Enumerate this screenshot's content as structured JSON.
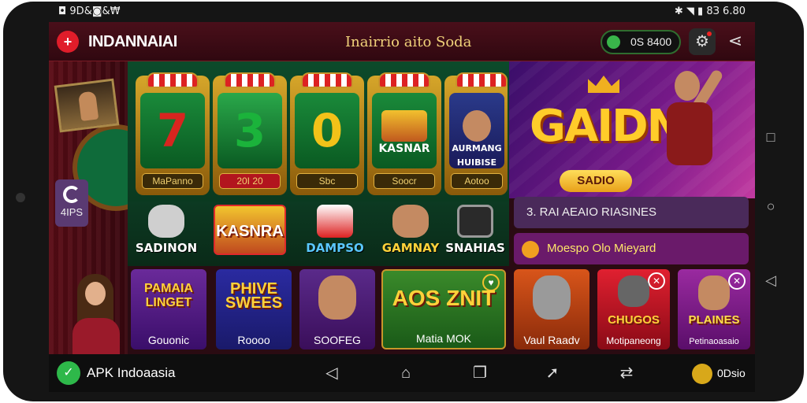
{
  "status_bar": {
    "left": "◘ 9D&◙&₩",
    "right": "✱ ◥ ▮ 8З 6.80"
  },
  "header": {
    "app_title": "INDANNAIAI",
    "center_text": "Inairrio aito Soda",
    "balance": "0S 8400"
  },
  "left": {
    "apps_label": "4IPS"
  },
  "slots": [
    {
      "symbol": "7",
      "label": "MaPanno",
      "color": "#d8251f"
    },
    {
      "symbol": "3",
      "label": "20I 20",
      "color": "#1bb33b"
    },
    {
      "symbol": "0",
      "label": "Sbc",
      "color": "#f2c219"
    },
    {
      "symbol": "",
      "title": "KASNAR",
      "label": "Soocr"
    },
    {
      "symbol": "",
      "title": "AURMANG HUIBISE",
      "label": "Aotoo"
    }
  ],
  "banner": {
    "title": "GAIDN",
    "button": "SADIO"
  },
  "info_rows": {
    "row1": "3. RAI AEAIO RIASINES",
    "row2": "Moespo Olo Mieyard"
  },
  "mid_items": [
    {
      "label": "SADINON"
    },
    {
      "label": "KASNRA"
    },
    {
      "label": "DAMPSO"
    },
    {
      "label": "GAMNAY"
    },
    {
      "label": "SNAHIAS"
    }
  ],
  "tiles": [
    {
      "art_text": "PAMAIA LINGET",
      "label": "Gouonic"
    },
    {
      "art_text": "PHIVE SWEES",
      "label": "Roooo"
    },
    {
      "art_text": "",
      "label": "SOOFEG"
    },
    {
      "art_text": "AOS ZNIT",
      "label": "Matia MOK"
    },
    {
      "art_text": "",
      "label": "Vaul Raadv"
    },
    {
      "art_text": "CHUGOS",
      "label": "Motipaneong"
    },
    {
      "art_text": "PLAINES",
      "label": "Petinaoasaio"
    }
  ],
  "bottom_bar": {
    "brand": "APK Indoaasia",
    "user": "0Dsio"
  },
  "colors": {
    "accent": "#e01d2a",
    "felt": "#0f6b3a",
    "gold": "#f2c12e"
  }
}
